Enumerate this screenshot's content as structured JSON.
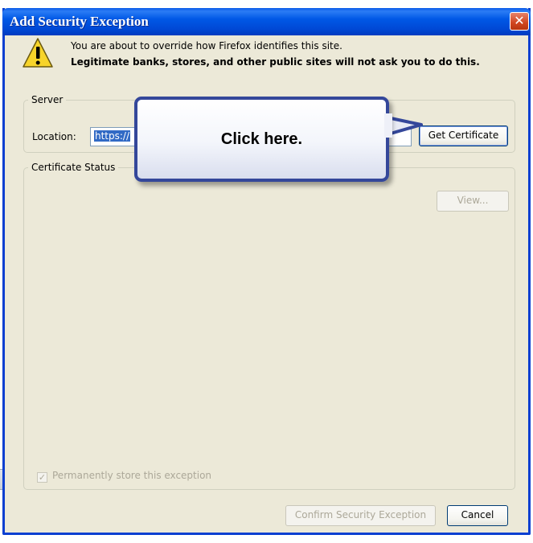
{
  "window": {
    "title": "Add Security Exception",
    "close_glyph": "✕"
  },
  "message": {
    "line1": "You are about to override how Firefox identifies this site.",
    "line2": "Legitimate banks, stores, and other public sites will not ask you to do this.",
    "icon": "warning-icon"
  },
  "server": {
    "legend": "Server",
    "location_label": "Location:",
    "location_value": "https://",
    "get_certificate_label": "Get Certificate"
  },
  "certificate_status": {
    "legend": "Certificate Status",
    "view_label": "View..."
  },
  "permanent": {
    "label": "Permanently store this exception",
    "checked": true
  },
  "buttons": {
    "confirm_label": "Confirm Security Exception",
    "cancel_label": "Cancel"
  },
  "callout": {
    "text": "Click here."
  },
  "colors": {
    "titlebar": "#0058e6",
    "dialog_bg": "#ece9d8",
    "callout_border": "#34479a"
  }
}
